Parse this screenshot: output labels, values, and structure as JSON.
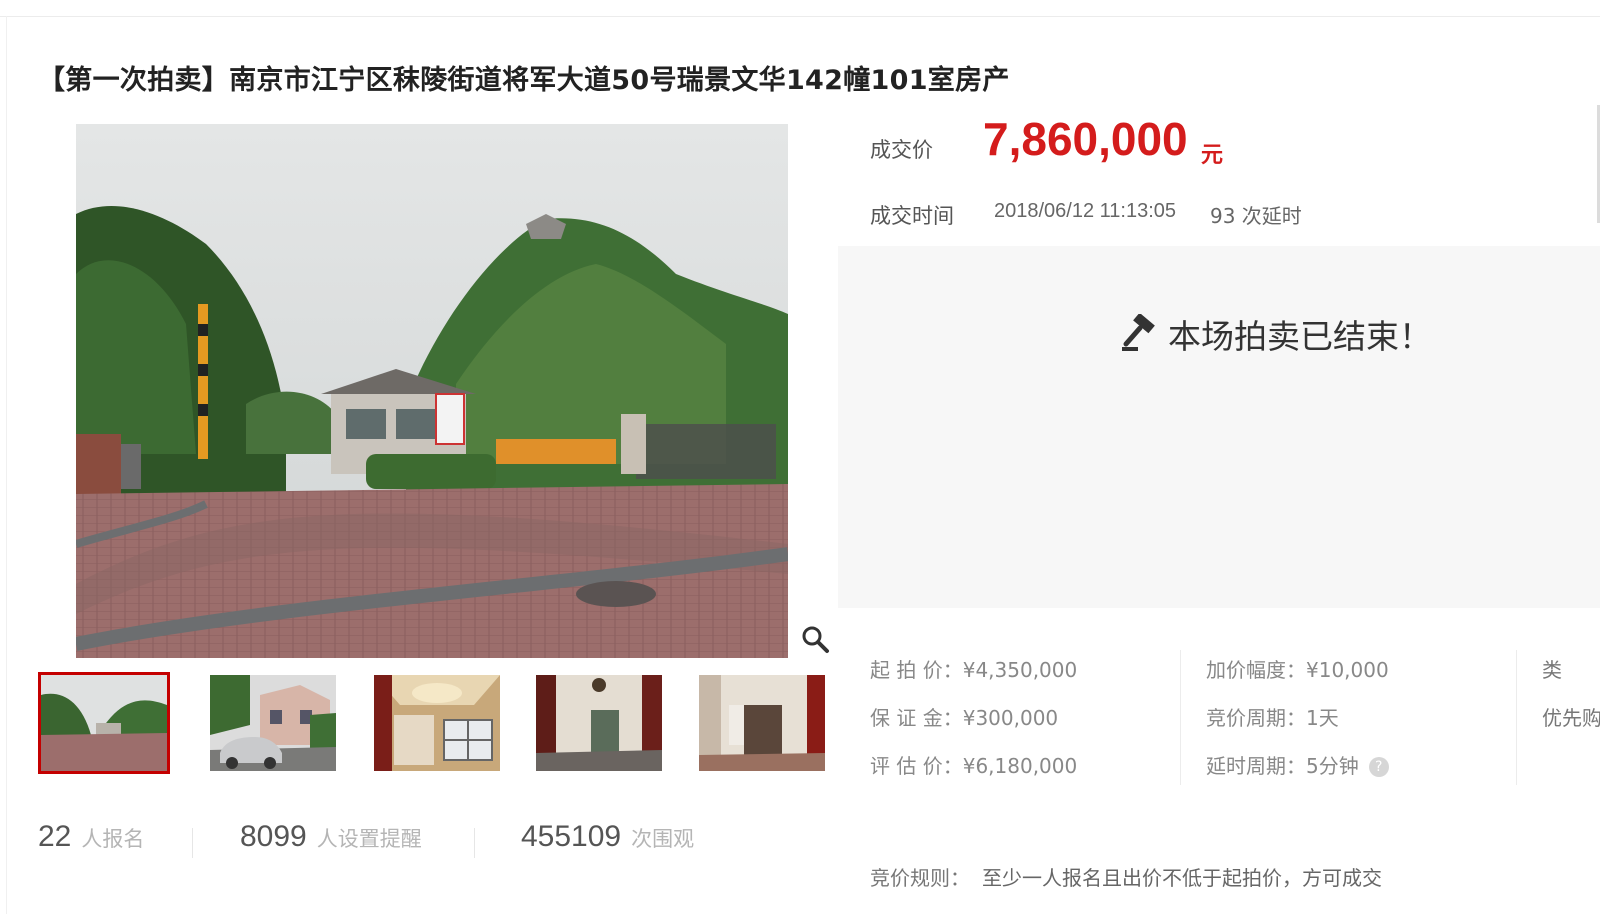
{
  "title": "【第一次拍卖】南京市江宁区秣陵街道将军大道50号瑞景文华142幢101室房产",
  "deal": {
    "price_label": "成交价",
    "price_value": "7,860,000",
    "price_unit": "元",
    "time_label": "成交时间",
    "time_value": "2018/06/12 11:13:05",
    "delay_count": "93 次延时"
  },
  "status": {
    "ended_text": "本场拍卖已结束！"
  },
  "gallery": {
    "thumbnails": [
      "gate-view",
      "house-with-car",
      "interior-ceiling",
      "interior-room",
      "interior-hallway"
    ],
    "active_index": 0
  },
  "stats": [
    {
      "num": "22",
      "unit": "人报名"
    },
    {
      "num": "8099",
      "unit": "人设置提醒"
    },
    {
      "num": "455109",
      "unit": "次围观"
    }
  ],
  "info": {
    "start_price": {
      "label": "起 拍 价：",
      "value": "¥4,350,000"
    },
    "deposit": {
      "label": "保 证 金：",
      "value": "¥300,000"
    },
    "appraisal": {
      "label": "评 估 价：",
      "value": "¥6,180,000"
    },
    "increment": {
      "label": "加价幅度：",
      "value": "¥10,000"
    },
    "cycle": {
      "label": "竞价周期：",
      "value": "1天"
    },
    "delay_cycle": {
      "label": "延时周期：",
      "value": "5分钟"
    },
    "type_label": "类",
    "priority_label": "优先购"
  },
  "rule": {
    "label": "竞价规则：",
    "text": "至少一人报名且出价不低于起拍价，方可成交"
  },
  "colors": {
    "price": "#d41c1c",
    "active_thumb": "#c40000"
  }
}
